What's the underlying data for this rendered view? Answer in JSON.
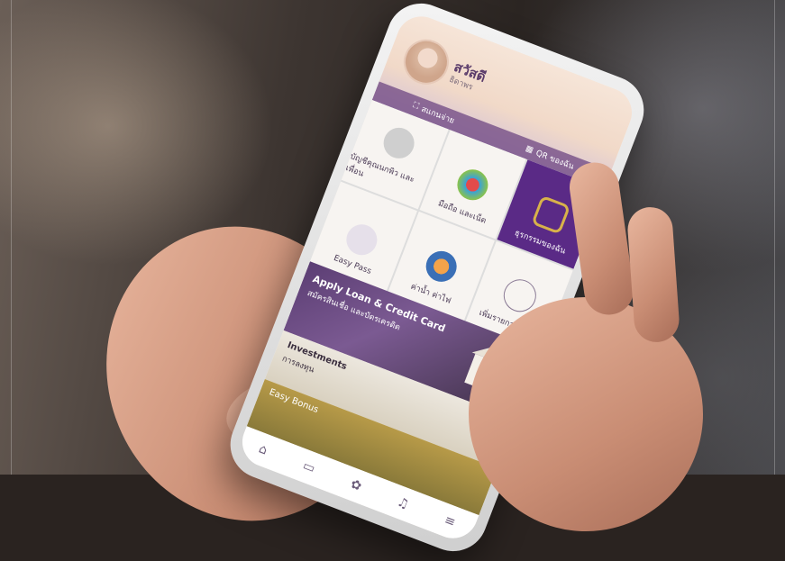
{
  "profile": {
    "greeting": "สวัสดี",
    "name": "ธิดาพร"
  },
  "actions": {
    "scan": "สแกนจ่าย",
    "qr": "QR ของฉัน"
  },
  "tiles": [
    {
      "label": "บัญชีคุณนกพิว และเพื่อน"
    },
    {
      "label": "มือถือ และเน็ต",
      "logo": "true"
    },
    {
      "label": "ธุรกรรมของฉัน"
    },
    {
      "label": "Easy Pass"
    },
    {
      "label": "ค่าน้ำ ค่าไฟ"
    },
    {
      "label": "เพิ่มรายการ โปรด"
    }
  ],
  "banners": {
    "loan_title": "Apply Loan & Credit Card",
    "loan_sub": "สมัครสินเชื่อ และบัตรเครดิต",
    "invest_title": "Investments",
    "invest_sub": "การลงทุน",
    "bonus": "Easy Bonus"
  },
  "nav": [
    "home-icon",
    "card-icon",
    "rewards-icon",
    "bell-icon",
    "menu-icon"
  ],
  "colors": {
    "brand_purple": "#5a2a86",
    "gold": "#b79a48"
  }
}
